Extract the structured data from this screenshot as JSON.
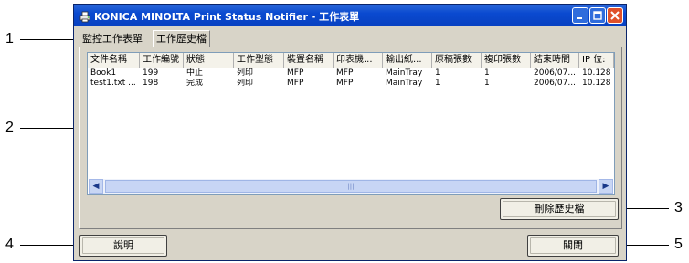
{
  "window": {
    "title": "KONICA MINOLTA Print Status Notifier - 工作表單",
    "controls": [
      "minimize-icon",
      "maximize-icon",
      "close-icon"
    ]
  },
  "tabs": [
    {
      "label": "監控工作表單",
      "active": false
    },
    {
      "label": "工作歷史檔",
      "active": true
    }
  ],
  "table": {
    "columns": [
      "文件名稱",
      "工作編號",
      "狀態",
      "工作型態",
      "裝置名稱",
      "印表機...",
      "輸出紙...",
      "原稿張數",
      "複印張數",
      "結束時間",
      "IP 位:"
    ],
    "rows": [
      [
        "Book1",
        "199",
        "中止",
        "列印",
        "MFP",
        "MFP",
        "MainTray",
        "1",
        "1",
        "2006/07...",
        "10.128"
      ],
      [
        "test1.txt ...",
        "198",
        "完成",
        "列印",
        "MFP",
        "MFP",
        "MainTray",
        "1",
        "1",
        "2006/07...",
        "10.128"
      ]
    ]
  },
  "buttons": {
    "delete_history": "刪除歷史檔",
    "help": "說明",
    "close": "關閉"
  },
  "callouts": [
    "1",
    "2",
    "3",
    "4",
    "5"
  ],
  "colors": {
    "titlebar": "#0a4ad0",
    "close_button": "#e0502a",
    "window_face": "#d8d4c8"
  }
}
